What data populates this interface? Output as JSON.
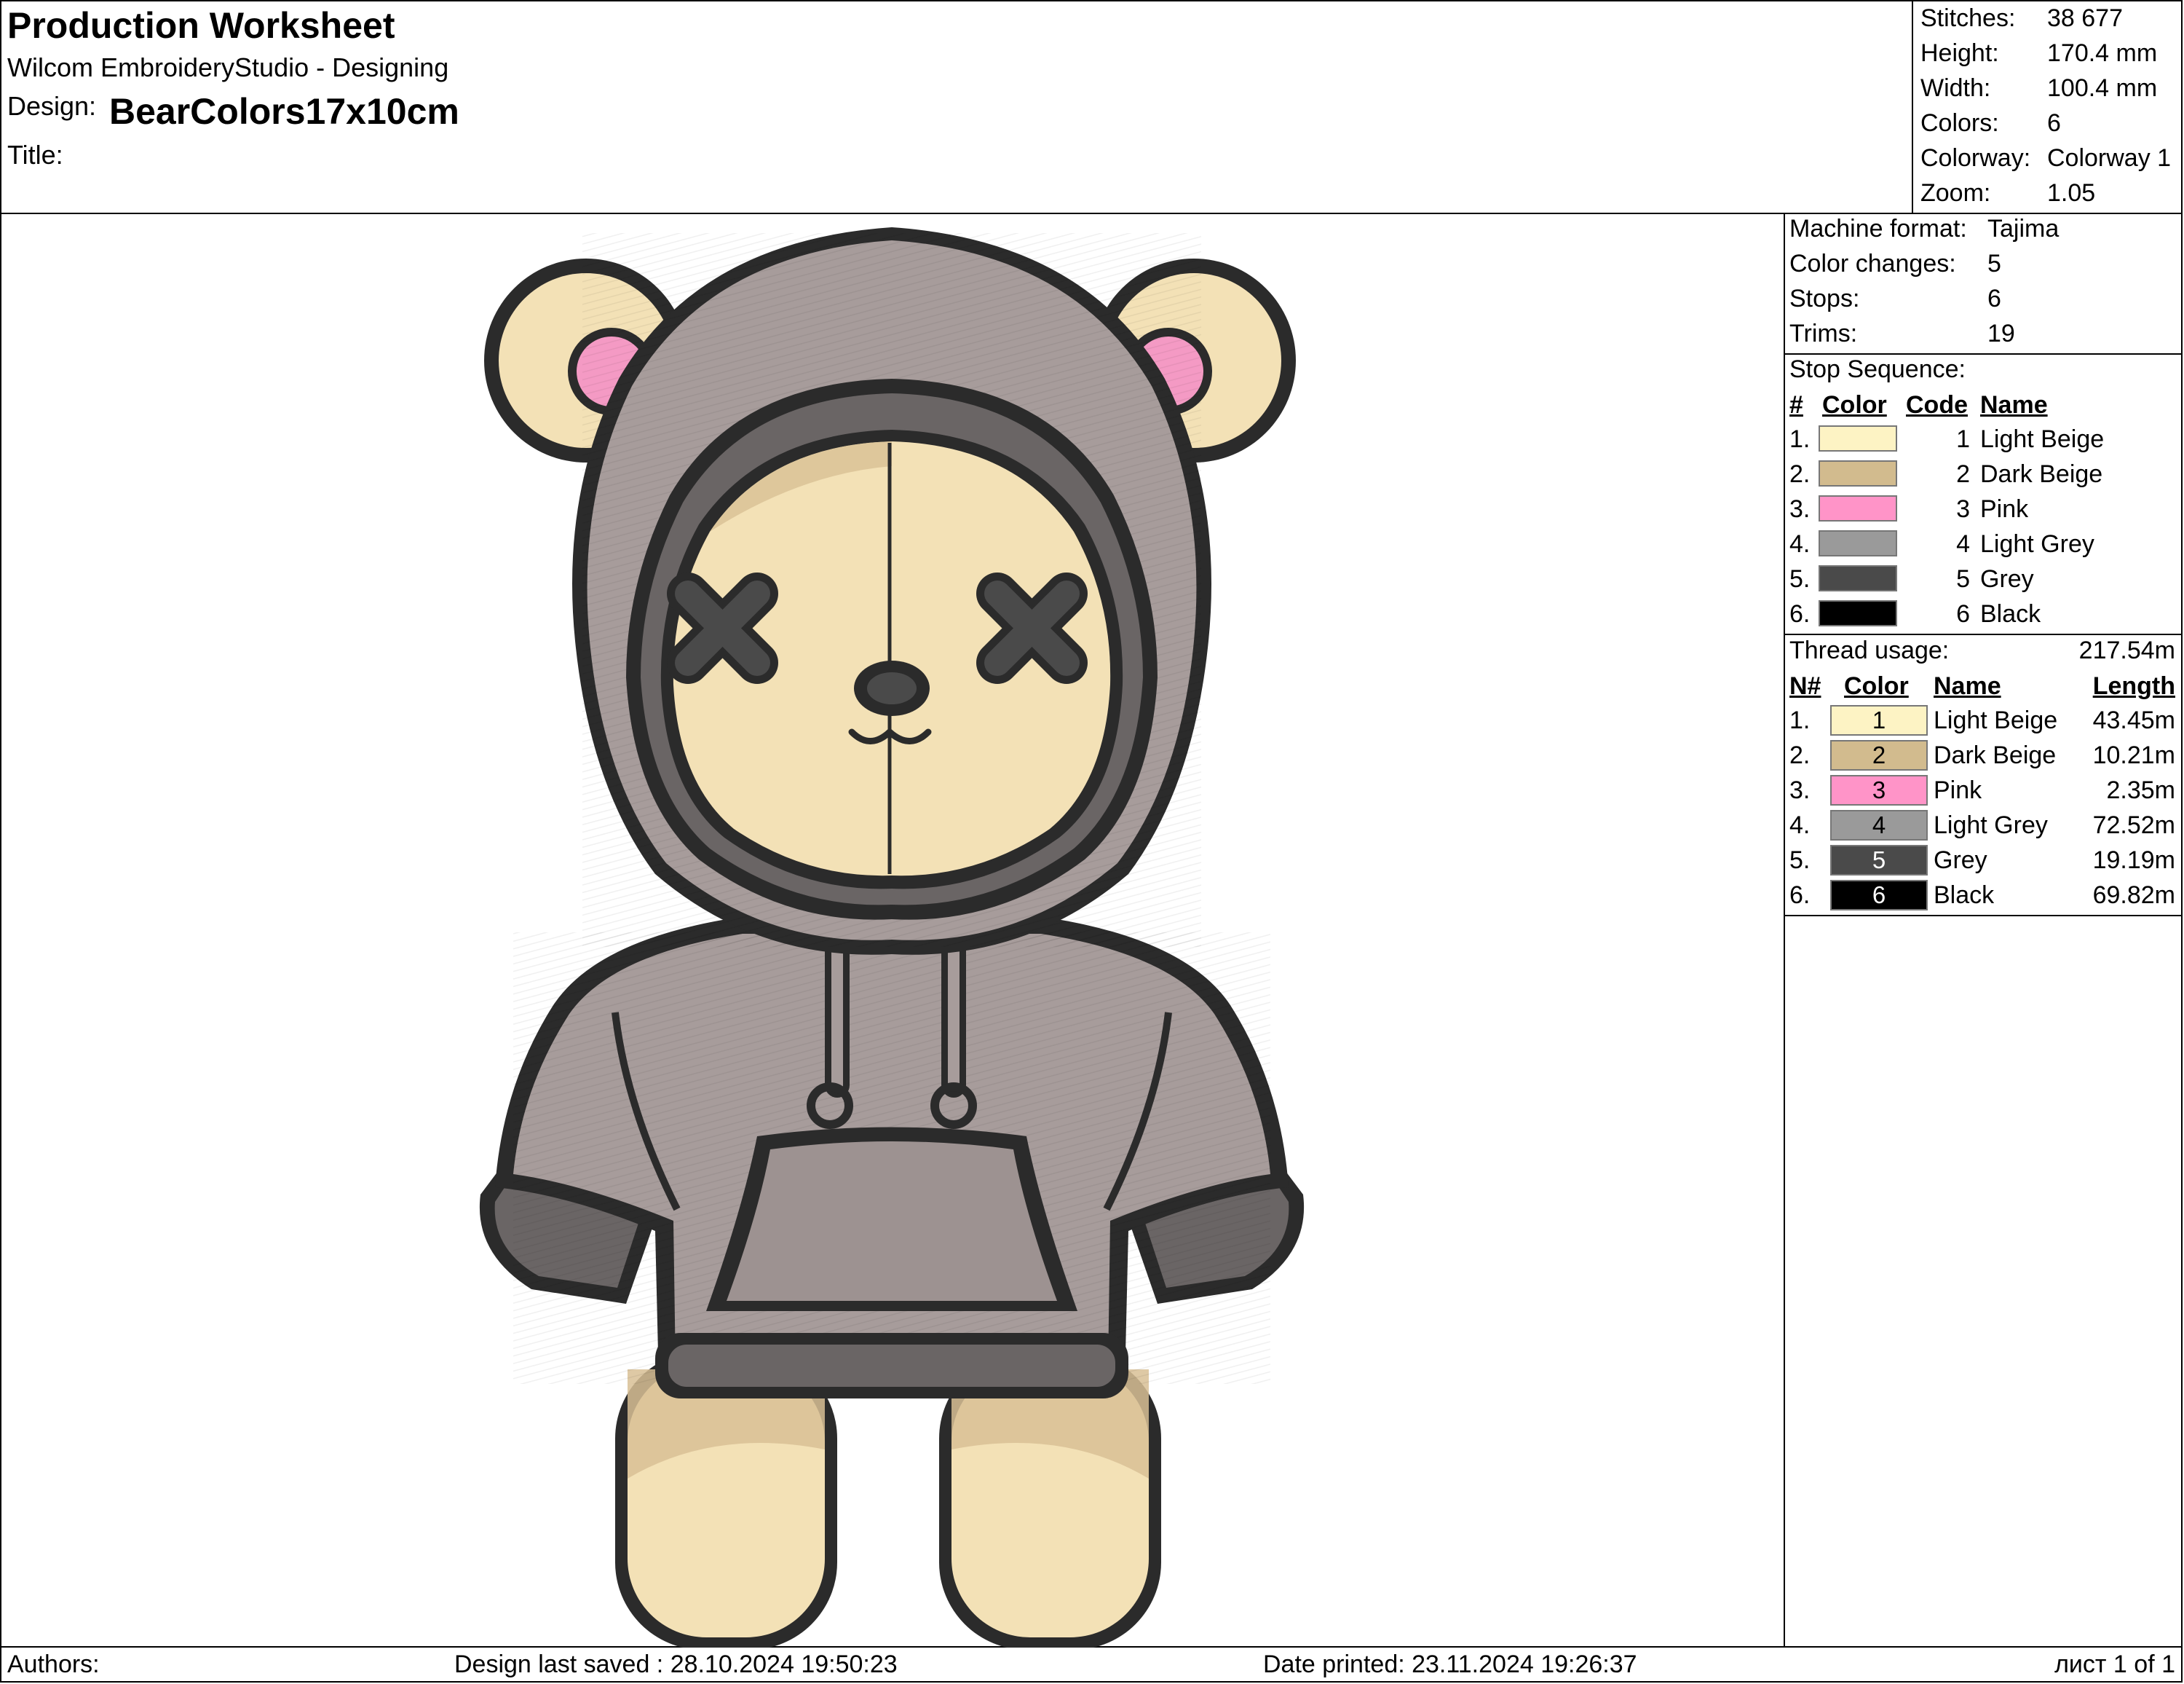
{
  "header": {
    "title": "Production Worksheet",
    "software": "Wilcom EmbroideryStudio - Designing",
    "design_label": "Design:",
    "design_name": "BearColors17x10cm",
    "title_label": "Title:",
    "title_value": ""
  },
  "stats": [
    {
      "label": "Stitches:",
      "value": "38 677"
    },
    {
      "label": "Height:",
      "value": "170.4 mm"
    },
    {
      "label": "Width:",
      "value": "100.4 mm"
    },
    {
      "label": "Colors:",
      "value": "6"
    },
    {
      "label": "Colorway:",
      "value": "Colorway 1"
    },
    {
      "label": "Zoom:",
      "value": "1.05"
    }
  ],
  "machine": [
    {
      "label": "Machine format:",
      "value": "Tajima"
    },
    {
      "label": "Color changes:",
      "value": "5"
    },
    {
      "label": "Stops:",
      "value": "6"
    },
    {
      "label": "Trims:",
      "value": "19"
    }
  ],
  "stop_sequence": {
    "title": "Stop Sequence:",
    "headers": {
      "num": "#",
      "color": "Color",
      "code": "Code",
      "name": "Name"
    },
    "rows": [
      {
        "num": "1.",
        "color": "#fdf3c4",
        "code": "1",
        "name": "Light Beige"
      },
      {
        "num": "2.",
        "color": "#d2bb8e",
        "code": "2",
        "name": "Dark Beige"
      },
      {
        "num": "3.",
        "color": "#ff94c8",
        "code": "3",
        "name": "Pink"
      },
      {
        "num": "4.",
        "color": "#9a9a9a",
        "code": "4",
        "name": "Light Grey"
      },
      {
        "num": "5.",
        "color": "#4a4a4a",
        "code": "5",
        "name": "Grey"
      },
      {
        "num": "6.",
        "color": "#000000",
        "code": "6",
        "name": "Black"
      }
    ]
  },
  "thread_usage": {
    "title": "Thread usage:",
    "total": "217.54m",
    "headers": {
      "num": "N#",
      "color": "Color",
      "name": "Name",
      "length": "Length"
    },
    "rows": [
      {
        "num": "1.",
        "color": "#fdf3c4",
        "code": "1",
        "text_color": "#000000",
        "name": "Light Beige",
        "length": "43.45m"
      },
      {
        "num": "2.",
        "color": "#d2bb8e",
        "code": "2",
        "text_color": "#000000",
        "name": "Dark Beige",
        "length": "10.21m"
      },
      {
        "num": "3.",
        "color": "#ff94c8",
        "code": "3",
        "text_color": "#000000",
        "name": "Pink",
        "length": "2.35m"
      },
      {
        "num": "4.",
        "color": "#9a9a9a",
        "code": "4",
        "text_color": "#000000",
        "name": "Light Grey",
        "length": "72.52m"
      },
      {
        "num": "5.",
        "color": "#4a4a4a",
        "code": "5",
        "text_color": "#ffffff",
        "name": "Grey",
        "length": "19.19m"
      },
      {
        "num": "6.",
        "color": "#000000",
        "code": "6",
        "text_color": "#ffffff",
        "name": "Black",
        "length": "69.82m"
      }
    ]
  },
  "footer": {
    "authors": "Authors:",
    "saved": "Design last saved : 28.10.2024 19:50:23",
    "printed": "Date printed: 23.11.2024 19:26:37",
    "page": "лист 1 of 1"
  },
  "colors": {
    "fur_light": "#f3e1b6",
    "fur_dark": "#d8c095",
    "ear_pink": "#f49ac4",
    "hoodie": "#a79c9b",
    "hoodie_dark": "#8f8584",
    "outline": "#2b2b2b"
  }
}
